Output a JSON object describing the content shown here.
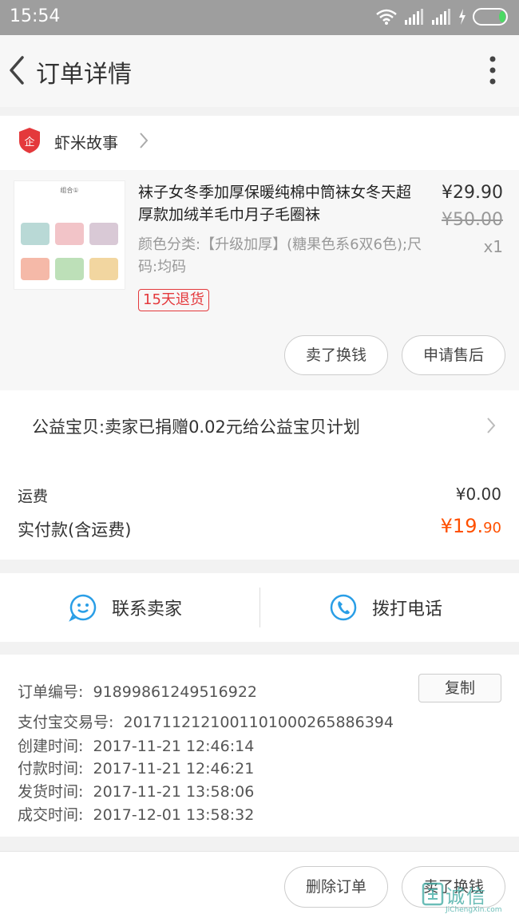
{
  "status_bar": {
    "time": "15:54"
  },
  "nav": {
    "title": "订单详情"
  },
  "shop": {
    "name": "虾米故事",
    "logo_text": "企"
  },
  "product": {
    "thumb_header": "组合①",
    "title": "袜子女冬季加厚保暖纯棉中筒袜女冬天超厚款加绒羊毛巾月子毛圈袜",
    "spec": "颜色分类:【升级加厚】(糖果色系6双6色);尺码:均码",
    "tag": "15天退货",
    "price": "¥29.90",
    "original_price": "¥50.00",
    "quantity": "x1",
    "buttons": {
      "sell": "卖了换钱",
      "after_sale": "申请售后"
    },
    "swatch_colors": [
      "#b9d9d6",
      "#f2c4c8",
      "#d9c9d6",
      "#f5b9a8",
      "#bde0b8",
      "#f2d6a0"
    ]
  },
  "charity": {
    "text": "公益宝贝:卖家已捐赠0.02元给公益宝贝计划"
  },
  "fees": {
    "shipping_label": "运费",
    "shipping_value": "¥0.00",
    "total_label": "实付款(含运费)",
    "total_main": "¥19.",
    "total_cents": "90",
    "accent_color": "#ff5000"
  },
  "contact": {
    "seller": "联系卖家",
    "phone": "拨打电话",
    "icon_color": "#2a9ee6"
  },
  "order": {
    "copy_label": "复制",
    "rows": [
      {
        "label": "订单编号:",
        "value": "91899861249516922"
      },
      {
        "label": "支付宝交易号:",
        "value": "2017112121001101000265886394"
      },
      {
        "label": "创建时间:",
        "value": "2017-11-21 12:46:14"
      },
      {
        "label": "付款时间:",
        "value": "2017-11-21 12:46:21"
      },
      {
        "label": "发货时间:",
        "value": "2017-11-21 13:58:06"
      },
      {
        "label": "成交时间:",
        "value": "2017-12-01 13:58:32"
      }
    ]
  },
  "bottom": {
    "delete": "删除订单",
    "sell": "卖了换钱"
  },
  "watermark": {
    "main": "诚信",
    "sub": "JiChengXin.com"
  }
}
